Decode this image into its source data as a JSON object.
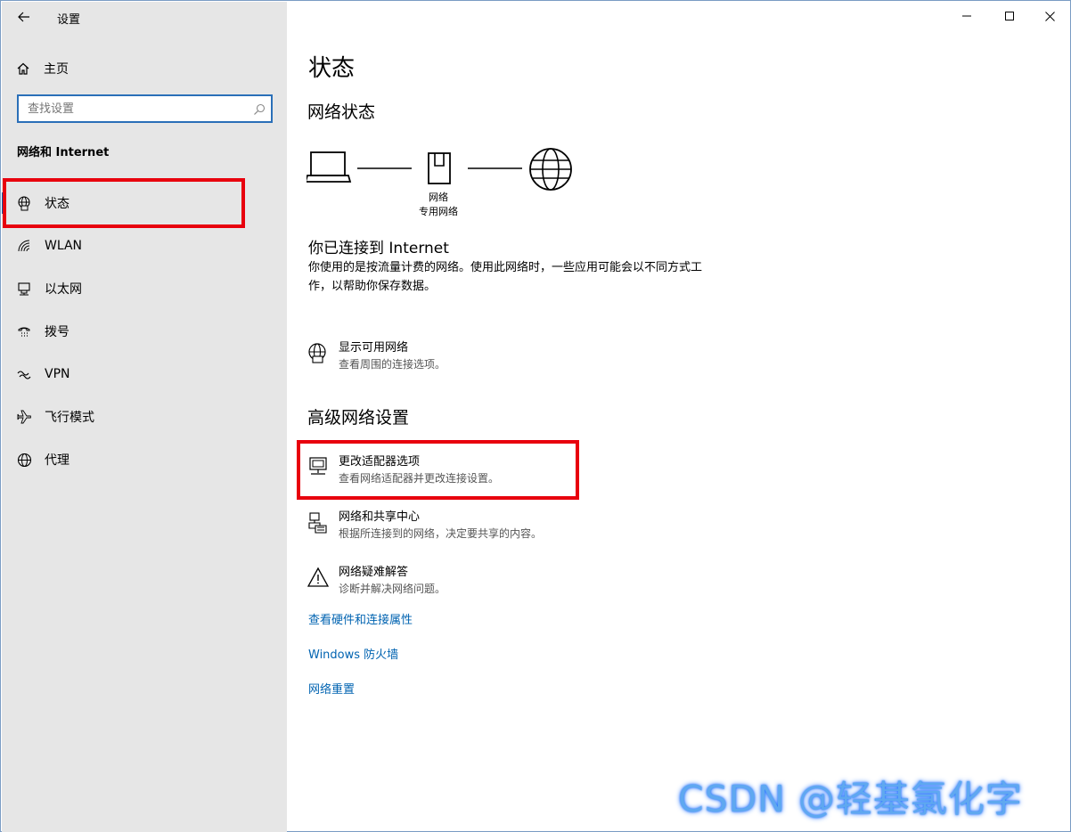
{
  "window": {
    "title": "设置",
    "controls": {
      "minimize_icon": "minimize-icon",
      "maximize_icon": "maximize-icon",
      "close_icon": "close-icon"
    }
  },
  "sidebar": {
    "home_label": "主页",
    "search": {
      "placeholder": "查找设置",
      "value": ""
    },
    "section_title": "网络和 Internet",
    "items": [
      {
        "label": "状态",
        "icon": "globe-status-icon",
        "active": true
      },
      {
        "label": "WLAN",
        "icon": "wifi-icon",
        "active": false
      },
      {
        "label": "以太网",
        "icon": "ethernet-icon",
        "active": false
      },
      {
        "label": "拨号",
        "icon": "dialup-icon",
        "active": false
      },
      {
        "label": "VPN",
        "icon": "vpn-icon",
        "active": false
      },
      {
        "label": "飞行模式",
        "icon": "airplane-icon",
        "active": false
      },
      {
        "label": "代理",
        "icon": "globe-icon",
        "active": false
      }
    ]
  },
  "main": {
    "title": "状态",
    "network_status_heading": "网络状态",
    "network_label_line1": "网络",
    "network_label_line2": "专用网络",
    "connected_title": "你已连接到 Internet",
    "connected_desc": "你使用的是按流量计费的网络。使用此网络时，一些应用可能会以不同方式工作，以帮助你保存数据。",
    "show_networks": {
      "title": "显示可用网络",
      "desc": "查看周围的连接选项。"
    },
    "advanced_heading": "高级网络设置",
    "adapter_options": {
      "title": "更改适配器选项",
      "desc": "查看网络适配器并更改连接设置。"
    },
    "sharing_center": {
      "title": "网络和共享中心",
      "desc": "根据所连接到的网络，决定要共享的内容。"
    },
    "troubleshooter": {
      "title": "网络疑难解答",
      "desc": "诊断并解决网络问题。"
    },
    "links": {
      "hardware": "查看硬件和连接属性",
      "firewall": "Windows 防火墙",
      "reset": "网络重置"
    }
  },
  "watermark": "CSDN @轻基氯化字",
  "colors": {
    "accent": "#0063b1",
    "highlight": "#e8000d",
    "sidebar_bg": "#e6e6e6"
  }
}
